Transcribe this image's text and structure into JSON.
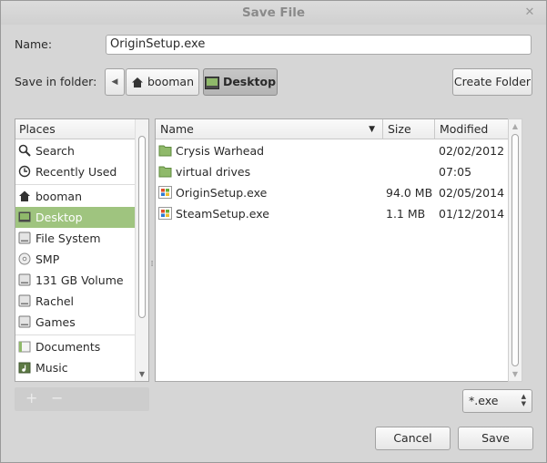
{
  "window": {
    "title": "Save File"
  },
  "name_field": {
    "label": "Name:",
    "value": "OriginSetup.exe"
  },
  "folder_row": {
    "label": "Save in folder:",
    "crumbs": [
      {
        "label": "booman"
      },
      {
        "label": "Desktop"
      }
    ],
    "create_folder_label": "Create Folder"
  },
  "places": {
    "header": "Places",
    "items": [
      {
        "label": "Search",
        "icon": "search-icon"
      },
      {
        "label": "Recently Used",
        "icon": "clock-icon"
      },
      {
        "label": "booman",
        "icon": "home-icon"
      },
      {
        "label": "Desktop",
        "icon": "desktop-icon",
        "selected": true
      },
      {
        "label": "File System",
        "icon": "drive-icon"
      },
      {
        "label": "SMP",
        "icon": "optical-disc-icon"
      },
      {
        "label": "131 GB Volume",
        "icon": "drive-icon"
      },
      {
        "label": "Rachel",
        "icon": "drive-icon"
      },
      {
        "label": "Games",
        "icon": "drive-icon"
      },
      {
        "label": "Documents",
        "icon": "folder-icon"
      },
      {
        "label": "Music",
        "icon": "music-folder-icon"
      }
    ],
    "add_label": "+",
    "remove_label": "−"
  },
  "files": {
    "columns": {
      "name": "Name",
      "size": "Size",
      "modified": "Modified"
    },
    "rows": [
      {
        "name": "Crysis Warhead",
        "size": "",
        "modified": "02/02/2012",
        "icon": "folder-icon"
      },
      {
        "name": "virtual drives",
        "size": "",
        "modified": "07:05",
        "icon": "folder-icon"
      },
      {
        "name": "OriginSetup.exe",
        "size": "94.0 MB",
        "modified": "02/05/2014",
        "icon": "windows-exe-icon"
      },
      {
        "name": "SteamSetup.exe",
        "size": "1.1 MB",
        "modified": "01/12/2014",
        "icon": "windows-exe-icon"
      }
    ]
  },
  "filter": {
    "value": "*.exe"
  },
  "actions": {
    "cancel_label": "Cancel",
    "save_label": "Save"
  },
  "colors": {
    "selection": "#9fc47f",
    "folder": "#8fb96a"
  }
}
